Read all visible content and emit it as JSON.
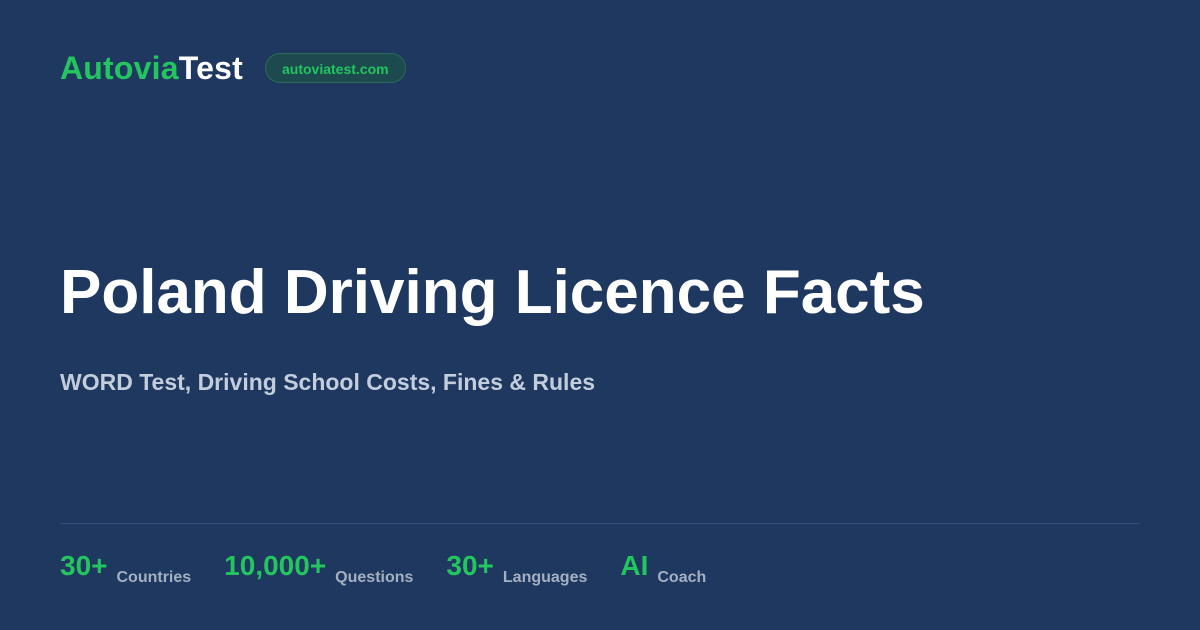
{
  "brand": {
    "logo_accent": "Autovia",
    "logo_plain": "Test",
    "domain": "autoviatest.com"
  },
  "hero": {
    "title": "Poland Driving Licence Facts",
    "subtitle": "WORD Test, Driving School Costs, Fines & Rules"
  },
  "stats": [
    {
      "value": "30+",
      "label": "Countries"
    },
    {
      "value": "10,000+",
      "label": "Questions"
    },
    {
      "value": "30+",
      "label": "Languages"
    },
    {
      "value": "AI",
      "label": "Coach"
    }
  ],
  "colors": {
    "background": "#1f3860",
    "accent": "#22c55e",
    "text_primary": "#ffffff",
    "text_secondary": "#c3cddb",
    "text_muted": "#a4b0c2"
  }
}
